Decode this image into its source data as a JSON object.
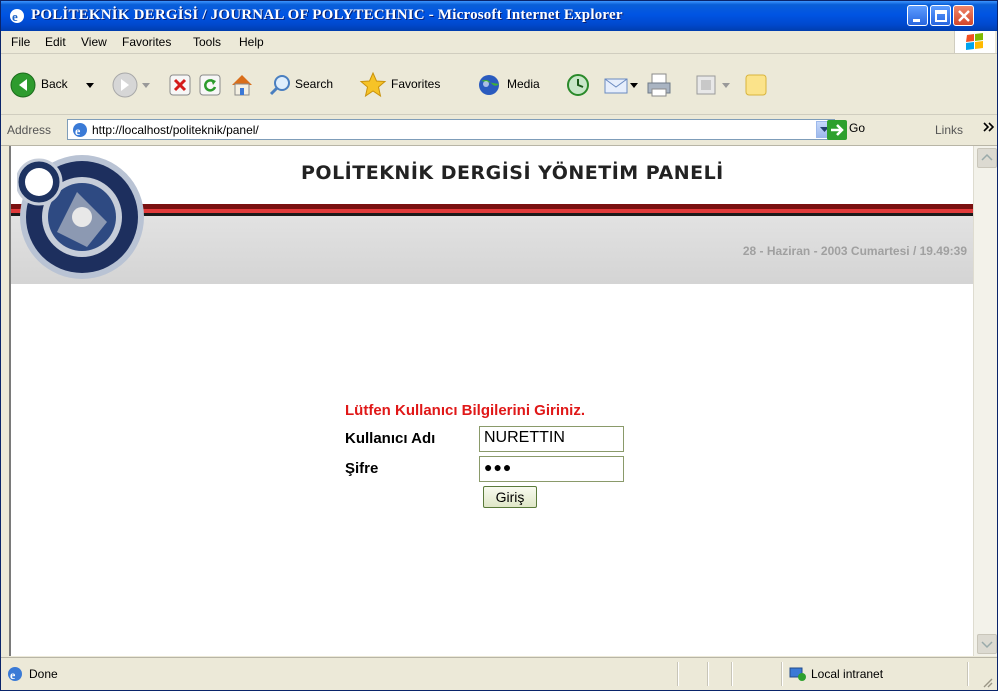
{
  "window": {
    "title": "POLİTEKNİK DERGİSİ / JOURNAL OF POLYTECHNIC - Microsoft Internet Explorer"
  },
  "menu": [
    "File",
    "Edit",
    "View",
    "Favorites",
    "Tools",
    "Help"
  ],
  "toolbar": {
    "back": "Back",
    "search": "Search",
    "favorites": "Favorites",
    "media": "Media"
  },
  "address": {
    "label": "Address",
    "url": "http://localhost/politeknik/panel/",
    "go": "Go",
    "links": "Links"
  },
  "page": {
    "title": "POLİTEKNİK DERGİSİ YÖNETİM PANELİ",
    "date": "28 - Haziran - 2003 Cumartesi / 19.49:39"
  },
  "login": {
    "heading": "Lütfen Kullanıcı Bilgilerini Giriniz.",
    "username_label": "Kullanıcı Adı",
    "username_value": "NURETTIN",
    "password_label": "Şifre",
    "password_mask": "●●●",
    "submit": "Giriş"
  },
  "status": {
    "text": "Done",
    "zone": "Local intranet"
  },
  "colors": {
    "titlebar": "#0054e3",
    "heading_red": "#e01818",
    "stripe": "#7a1010"
  }
}
